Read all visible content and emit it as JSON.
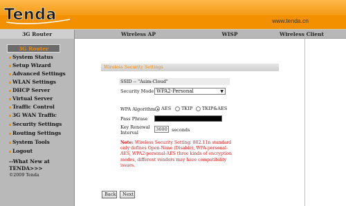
{
  "brand": {
    "logo_text": "Tenda",
    "site_url": "www.tenda.cn",
    "color": "#f29000"
  },
  "tabs": [
    {
      "label": "3G Router",
      "active": true
    },
    {
      "label": "Wireless AP",
      "active": false
    },
    {
      "label": "WISP",
      "active": false
    },
    {
      "label": "Wireless Client",
      "active": false
    }
  ],
  "sidebar": {
    "title": "3G Router",
    "items": [
      {
        "label": "System Status"
      },
      {
        "label": "Setup Wizard"
      },
      {
        "label": "Advanced Settings"
      },
      {
        "label": "WLAN Settings"
      },
      {
        "label": "DHCP Server"
      },
      {
        "label": "Virtual Server"
      },
      {
        "label": "Traffic Control"
      },
      {
        "label": "3G WAN Traffic"
      },
      {
        "label": "Security Settings"
      },
      {
        "label": "Routing Settings"
      },
      {
        "label": "System Tools"
      },
      {
        "label": "Logout"
      }
    ],
    "more_link": "--What New at TENDA>>>",
    "copyright": "©2009 Tenda"
  },
  "panel": {
    "title": "Wireless Security Settings",
    "ssid_line": "SSID -- \"Asim-Cloud\"",
    "security_mode_label": "Security Mode",
    "security_mode_value": "WPA2-Personal",
    "wpa_algorithms_label": "WPA Algorithms",
    "algorithms": [
      {
        "label": "AES",
        "checked": true
      },
      {
        "label": "TKIP",
        "checked": false
      },
      {
        "label": "TKIP&AES",
        "checked": false
      }
    ],
    "pass_phrase_label": "Pass Phrase",
    "key_renewal_label_1": "Key Renewal",
    "key_renewal_label_2": "Interval",
    "key_renewal_value": "3600",
    "key_renewal_unit": "seconds",
    "note_label": "Note:",
    "note_text": " Wireless Security Setting: 802.11n standard only defines Open-None (Disable), WPA-personal-AES, WPA2-personal-AES three kinds of encryption modes, different vendors may have compatibility issues.",
    "back_label": "Back",
    "next_label": "Next"
  }
}
